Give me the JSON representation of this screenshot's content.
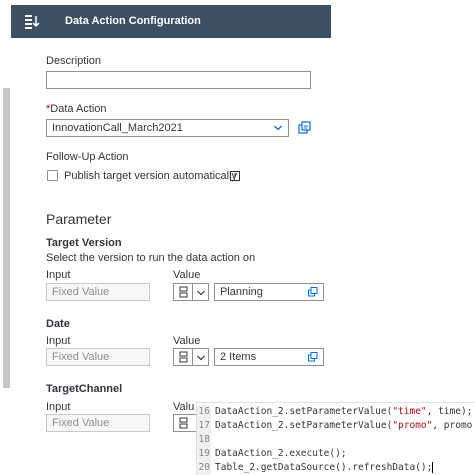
{
  "header": {
    "title": "Data Action Configuration",
    "icon": "data-action-list-icon"
  },
  "description": {
    "label": "Description",
    "value": ""
  },
  "data_action": {
    "required_mark": "*",
    "label": "Data Action",
    "value": "InnovationCall_March2021"
  },
  "follow_up": {
    "label": "Follow-Up Action",
    "checkbox_label": "Publish target version automatically",
    "checked": false,
    "info_glyph": "i"
  },
  "parameter": {
    "title": "Parameter",
    "target_version": {
      "title": "Target Version",
      "hint": "Select the version to run the data action on",
      "input_label": "Input",
      "input_value": "Fixed Value",
      "value_label": "Value",
      "value": "Planning"
    },
    "date": {
      "title": "Date",
      "input_label": "Input",
      "input_value": "Fixed Value",
      "value_label": "Value",
      "value": "2 Items"
    },
    "target_channel": {
      "title": "TargetChannel",
      "input_label": "Input",
      "input_value": "Fixed Value",
      "value_label": "Valu"
    }
  },
  "code": {
    "lines": [
      {
        "num": "16",
        "pre": "DataAction_2.setParameterValue(",
        "str": "\"time\"",
        "post": ", time);"
      },
      {
        "num": "17",
        "pre": "DataAction_2.setParameterValue(",
        "str": "\"promo\"",
        "post": ", promo);"
      },
      {
        "num": "18",
        "pre": "",
        "str": "",
        "post": ""
      },
      {
        "num": "19",
        "pre": "DataAction_2.execute();",
        "str": "",
        "post": ""
      },
      {
        "num": "20",
        "pre": "Table_2.getDataSource().refreshData();",
        "str": "",
        "post": ""
      }
    ]
  },
  "colors": {
    "header_bg": "#3c4f63",
    "required": "#bb0000",
    "accent": "#0a6ed1",
    "string": "#a31515"
  }
}
